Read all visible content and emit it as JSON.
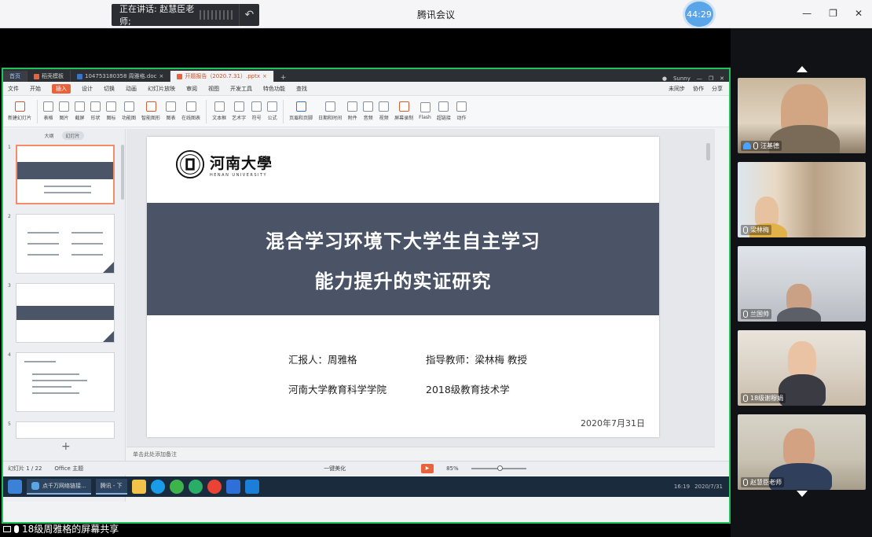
{
  "meeting": {
    "app_title": "腾讯会议",
    "speaking_label": "正在讲话: 赵慧臣老师;",
    "timer": "44:29",
    "share_label": "18级周雅格的屏幕共享",
    "accent": "#5aa4e8"
  },
  "participants": [
    {
      "name": "汪基德"
    },
    {
      "name": "梁林梅"
    },
    {
      "name": "兰国帅"
    },
    {
      "name": "18级谢穆娟"
    },
    {
      "name": "赵慧臣老师"
    }
  ],
  "wps": {
    "tabs": [
      {
        "label": "首页"
      },
      {
        "label": "稻壳模板"
      },
      {
        "label": "104753180358 周雅格.doc"
      },
      {
        "label": "开题报告（2020.7.31）.pptx"
      }
    ],
    "user": "Sunny",
    "menu": [
      "文件",
      "开始",
      "插入",
      "设计",
      "切换",
      "动画",
      "幻灯片放映",
      "审阅",
      "视图",
      "开发工具",
      "特色功能",
      "查找"
    ],
    "menu_right": [
      "未同步",
      "协作",
      "分享"
    ],
    "ribbon": [
      "新建幻灯片",
      "表格",
      "图片",
      "截屏",
      "形状",
      "图标",
      "功能图",
      "智能图形",
      "图表",
      "在线图表",
      "文本框",
      "艺术字",
      "符号",
      "公式",
      "页眉和页脚",
      "日期和时间",
      "附件",
      "音频",
      "视频",
      "屏幕录制",
      "Flash",
      "超链接",
      "动作"
    ],
    "panel_tabs": {
      "outline": "大纲",
      "slides": "幻灯片"
    },
    "thumb_numbers": [
      "1",
      "2",
      "3",
      "4",
      "5"
    ],
    "notes_placeholder": "单击此处添加备注",
    "status": {
      "slide_count": "幻灯片 1 / 22",
      "theme": "Office 主题",
      "beautify": "一键美化",
      "zoom": "85%",
      "time": "16:19",
      "date": "2020/7/31"
    },
    "taskbar_tasks": [
      "点千万网络链接...",
      "腾讯 - 下"
    ]
  },
  "slide": {
    "logo_cn": "河南大學",
    "logo_en": "HENAN UNIVERSITY",
    "title_line1": "混合学习环境下大学生自主学习",
    "title_line2": "能力提升的实证研究",
    "reporter": "汇报人：周雅格",
    "advisor": "指导教师：梁林梅 教授",
    "college": "河南大学教育科学学院",
    "major": "2018级教育技术学",
    "date": "2020年7月31日"
  }
}
